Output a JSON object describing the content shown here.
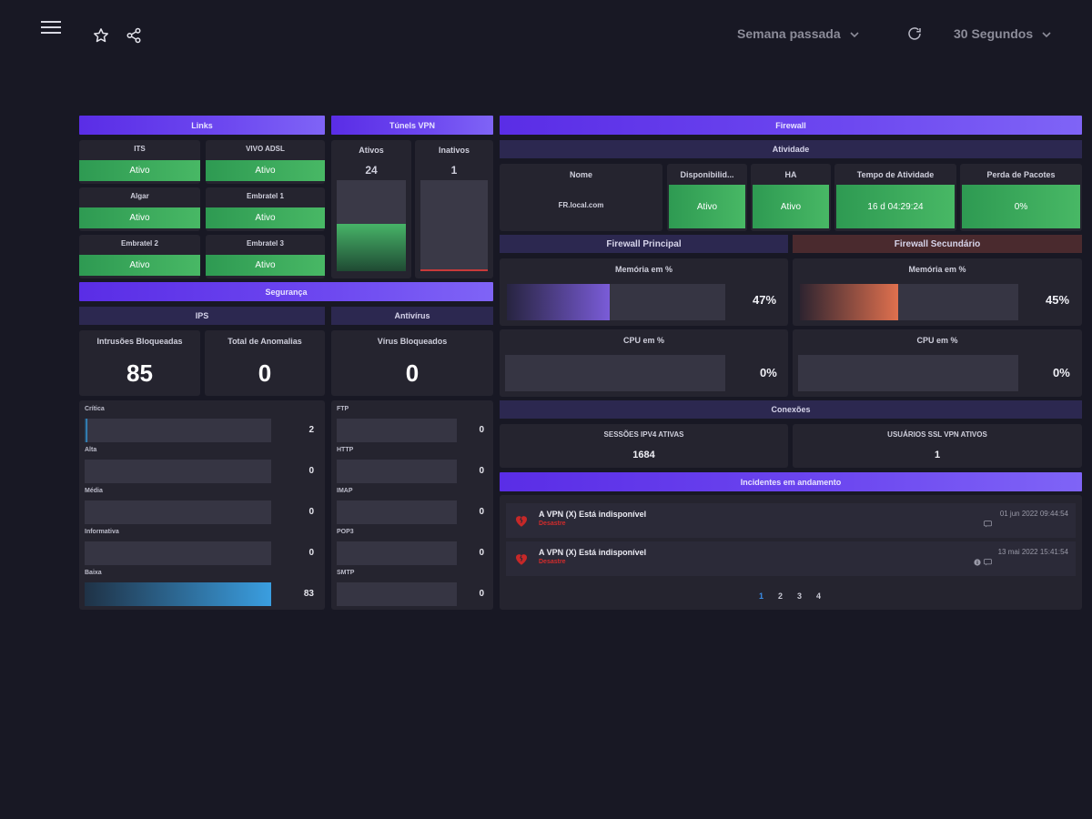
{
  "topbar": {
    "time_range": "Semana passada",
    "refresh_interval": "30 Segundos"
  },
  "links": {
    "title": "Links",
    "items": [
      {
        "name": "ITS",
        "status": "Ativo"
      },
      {
        "name": "VIVO ADSL",
        "status": "Ativo"
      },
      {
        "name": "Algar",
        "status": "Ativo"
      },
      {
        "name": "Embratel 1",
        "status": "Ativo"
      },
      {
        "name": "Embratel 2",
        "status": "Ativo"
      },
      {
        "name": "Embratel 3",
        "status": "Ativo"
      }
    ]
  },
  "vpn": {
    "title": "Túnels VPN",
    "active_label": "Ativos",
    "active_value": "24",
    "active_fraction": 0.52,
    "inactive_label": "Inativos",
    "inactive_value": "1",
    "inactive_fraction": 0.02
  },
  "seguranca": {
    "title": "Segurança",
    "ips_title": "IPS",
    "antivirus_title": "Antivírus",
    "intrusions_label": "Intrusões Bloqueadas",
    "intrusions_value": "85",
    "anomalies_label": "Total de Anomalias",
    "anomalies_value": "0",
    "virus_label": "Vírus Bloqueados",
    "virus_value": "0",
    "severity": [
      {
        "label": "Crítica",
        "value": "2",
        "fraction": 0.015
      },
      {
        "label": "Alta",
        "value": "0",
        "fraction": 0
      },
      {
        "label": "Média",
        "value": "0",
        "fraction": 0
      },
      {
        "label": "Informativa",
        "value": "0",
        "fraction": 0
      },
      {
        "label": "Baixa",
        "value": "83",
        "fraction": 1
      }
    ],
    "protocols": [
      {
        "label": "FTP",
        "value": "0"
      },
      {
        "label": "HTTP",
        "value": "0"
      },
      {
        "label": "IMAP",
        "value": "0"
      },
      {
        "label": "POP3",
        "value": "0"
      },
      {
        "label": "SMTP",
        "value": "0"
      }
    ]
  },
  "firewall": {
    "title": "Firewall",
    "activity_title": "Atividade",
    "columns": {
      "name": "Nome",
      "availability": "Disponibilid...",
      "ha": "HA",
      "uptime": "Tempo de Atividade",
      "packet_loss": "Perda de Pacotes"
    },
    "values": {
      "name": "FR.local.com",
      "availability": "Ativo",
      "ha": "Ativo",
      "uptime": "16 d 04:29:24",
      "packet_loss": "0%"
    },
    "primary": {
      "title": "Firewall Principal",
      "mem_label": "Memória em %",
      "mem_value": "47%",
      "mem_fraction": 0.47,
      "cpu_label": "CPU em %",
      "cpu_value": "0%"
    },
    "secondary": {
      "title": "Firewall Secundário",
      "mem_label": "Memória em %",
      "mem_value": "45%",
      "mem_fraction": 0.45,
      "cpu_label": "CPU em %",
      "cpu_value": "0%"
    }
  },
  "conexoes": {
    "title": "Conexões",
    "ipv4_label": "SESSÕES IPV4 ATIVAS",
    "ipv4_value": "1684",
    "vpn_users_label": "USUÁRIOS SSL VPN ATIVOS",
    "vpn_users_value": "1"
  },
  "incidents": {
    "title": "Incidentes em andamento",
    "items": [
      {
        "title": "A VPN (X) Está indisponível",
        "status": "Desastre",
        "date": "01 jun 2022 09:44:54"
      },
      {
        "title": "A VPN (X) Está indisponível",
        "status": "Desastre",
        "date": "13 mai 2022 15:41:54"
      }
    ],
    "pages": [
      "1",
      "2",
      "3",
      "4"
    ]
  },
  "colors": {
    "background": "#181824",
    "panel": "#25242f",
    "header_gradient_start": "#5a2de6",
    "ok_green": "#3fa85c",
    "disaster_red": "#d22c2c",
    "primary_bar": "#7a5cd8",
    "secondary_bar": "#e0704e",
    "secondary_header": "#4a2a2e"
  }
}
